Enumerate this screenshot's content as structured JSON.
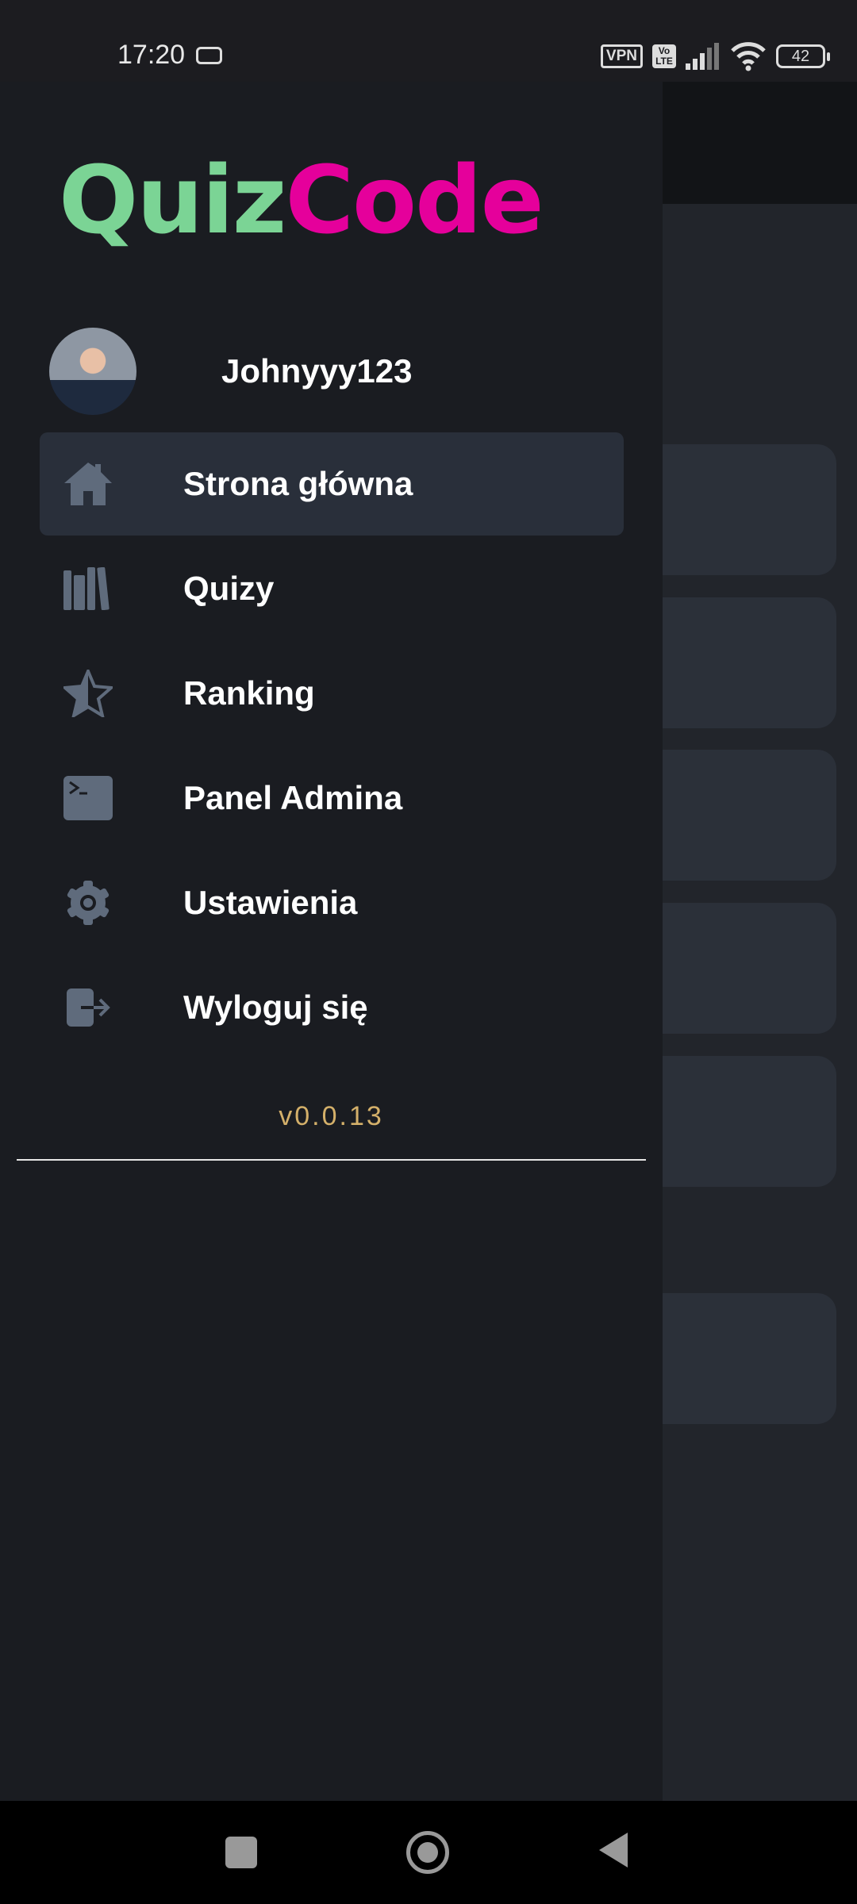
{
  "status_bar": {
    "time": "17:20",
    "vpn": "VPN",
    "volte": "Vo LTE",
    "battery": "42"
  },
  "logo": {
    "part1": "Quiz",
    "part2": "Code"
  },
  "user": {
    "name": "Johnyyy123"
  },
  "menu": [
    {
      "label": "Strona główna",
      "icon": "home-icon",
      "active": true
    },
    {
      "label": "Quizy",
      "icon": "books-icon"
    },
    {
      "label": "Ranking",
      "icon": "star-icon"
    },
    {
      "label": "Panel Admina",
      "icon": "terminal-icon"
    },
    {
      "label": "Ustawienia",
      "icon": "gear-icon"
    },
    {
      "label": "Wyloguj się",
      "icon": "logout-icon"
    }
  ],
  "version": "v0.0.13",
  "colors": {
    "accent_green": "#7bd495",
    "accent_pink": "#e5009b",
    "version": "#d4b06a",
    "drawer_bg": "#1a1c21",
    "active_bg": "#292f3a",
    "icon": "#5f6b7c"
  }
}
